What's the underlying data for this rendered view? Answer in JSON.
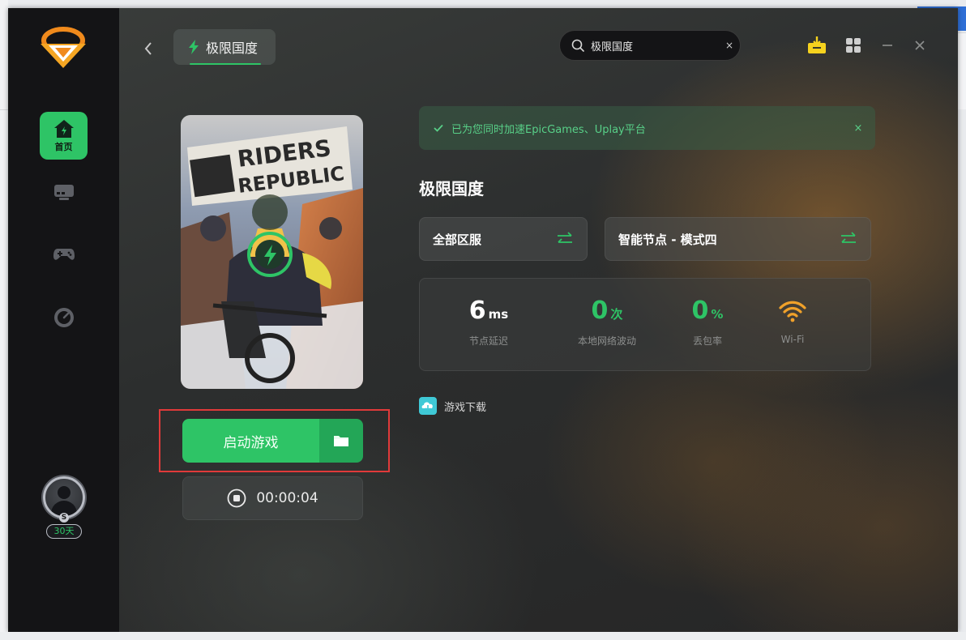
{
  "window": {
    "title": "极限国度"
  },
  "sidebar": {
    "items": [
      {
        "label": "首页",
        "icon": "home-icon",
        "active": true
      },
      {
        "label": "",
        "icon": "monitor-icon",
        "active": false
      },
      {
        "label": "",
        "icon": "gamepad-icon",
        "active": false
      },
      {
        "label": "",
        "icon": "speedometer-icon",
        "active": false
      }
    ],
    "user": {
      "badge": "S",
      "days": "30天"
    }
  },
  "header": {
    "tab_label": "极限国度",
    "search_value": "极限国度",
    "clear_label": "×"
  },
  "game": {
    "name": "极限国度",
    "cover_title_line1": "RIDERS",
    "cover_title_line2": "REPUBLIC",
    "launch_label": "启动游戏",
    "timer": "00:00:04"
  },
  "notice": {
    "message": "已为您同时加速EpicGames、Uplay平台",
    "close_label": "×"
  },
  "selectors": {
    "region": "全部区服",
    "node": "智能节点 - 模式四"
  },
  "stats": [
    {
      "value": "6",
      "unit": "ms",
      "caption": "节点延迟",
      "color": "#ffffff"
    },
    {
      "value": "0",
      "unit": "次",
      "caption": "本地网络波动",
      "color": "#2ec466"
    },
    {
      "value": "0",
      "unit": "%",
      "caption": "丢包率",
      "color": "#2ec466"
    },
    {
      "value": "",
      "unit": "",
      "caption": "Wi-Fi",
      "color": "#f0a12a"
    }
  ],
  "download": {
    "label": "游戏下载"
  },
  "colors": {
    "accent": "#2ec466",
    "sidebar": "#141416",
    "warning": "#f0a12a",
    "highlight_outline": "#e03a3a"
  }
}
